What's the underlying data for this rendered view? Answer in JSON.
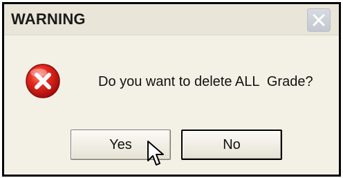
{
  "dialog": {
    "title": "WARNING",
    "message": "Do you want to delete ALL  Grade?",
    "icon": "error-icon",
    "buttons": {
      "yes_label": "Yes",
      "no_label": "No"
    }
  },
  "colors": {
    "titlebar_bg": "#e9e5d8",
    "dialog_bg": "#f3f1e6",
    "error_red": "#d21c1c",
    "close_button_bg": "#c8ccd3"
  },
  "cursor": "arrow-cursor"
}
